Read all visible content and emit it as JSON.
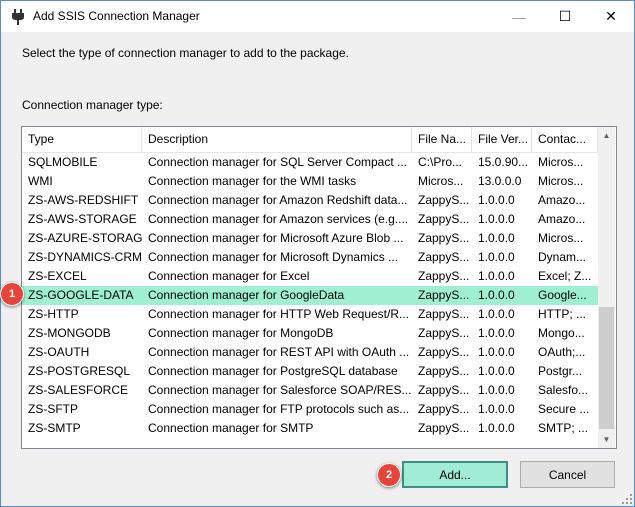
{
  "window": {
    "title": "Add SSIS Connection Manager",
    "minimize_glyph": "—",
    "maximize_glyph": "☐",
    "close_glyph": "✕"
  },
  "instruction": "Select the type of connection manager to add to the package.",
  "list_label": "Connection manager type:",
  "columns": [
    "Type",
    "Description",
    "File Na...",
    "File Ver...",
    "Contac..."
  ],
  "rows": [
    [
      "SQLMOBILE",
      "Connection manager for SQL Server Compact ...",
      "C:\\Pro...",
      "15.0.90...",
      "Micros..."
    ],
    [
      "WMI",
      "Connection manager for the WMI tasks",
      "Micros...",
      "13.0.0.0",
      "Micros..."
    ],
    [
      "ZS-AWS-REDSHIFT",
      "Connection manager for Amazon Redshift data...",
      "ZappyS...",
      "1.0.0.0",
      "Amazo..."
    ],
    [
      "ZS-AWS-STORAGE",
      "Connection manager for Amazon services (e.g....",
      "ZappyS...",
      "1.0.0.0",
      "Amazo..."
    ],
    [
      "ZS-AZURE-STORAGE",
      "Connection manager for Microsoft Azure Blob ...",
      "ZappyS...",
      "1.0.0.0",
      "Micros..."
    ],
    [
      "ZS-DYNAMICS-CRM",
      "Connection manager for Microsoft Dynamics ...",
      "ZappyS...",
      "1.0.0.0",
      "Dynam..."
    ],
    [
      "ZS-EXCEL",
      "Connection manager for Excel",
      "ZappyS...",
      "1.0.0.0",
      "Excel; Z..."
    ],
    [
      "ZS-GOOGLE-DATA",
      "Connection manager for GoogleData",
      "ZappyS...",
      "1.0.0.0",
      "Google..."
    ],
    [
      "ZS-HTTP",
      "Connection manager for HTTP Web Request/R...",
      "ZappyS...",
      "1.0.0.0",
      "HTTP; ..."
    ],
    [
      "ZS-MONGODB",
      "Connection manager for MongoDB",
      "ZappyS...",
      "1.0.0.0",
      "Mongo..."
    ],
    [
      "ZS-OAUTH",
      "Connection manager for REST API with OAuth ...",
      "ZappyS...",
      "1.0.0.0",
      "OAuth;..."
    ],
    [
      "ZS-POSTGRESQL",
      "Connection manager for PostgreSQL database",
      "ZappyS...",
      "1.0.0.0",
      "Postgr..."
    ],
    [
      "ZS-SALESFORCE",
      "Connection manager for Salesforce SOAP/RES...",
      "ZappyS...",
      "1.0.0.0",
      "Salesfo..."
    ],
    [
      "ZS-SFTP",
      "Connection manager for FTP protocols such as...",
      "ZappyS...",
      "1.0.0.0",
      "Secure ..."
    ],
    [
      "ZS-SMTP",
      "Connection manager for SMTP",
      "ZappyS...",
      "1.0.0.0",
      "SMTP; ..."
    ]
  ],
  "selected_row": 7,
  "badges": {
    "step1": "1",
    "step2": "2",
    "color": "#e8443a"
  },
  "buttons": {
    "add": "Add...",
    "cancel": "Cancel"
  },
  "colors": {
    "selection": "#9ff0d0",
    "add_button": "#a0ecd5",
    "window_border": "#5a8dc8"
  },
  "icons": {
    "app": "ssis-plug-icon",
    "scroll_up": "chevron-up-icon",
    "scroll_down": "chevron-down-icon"
  }
}
